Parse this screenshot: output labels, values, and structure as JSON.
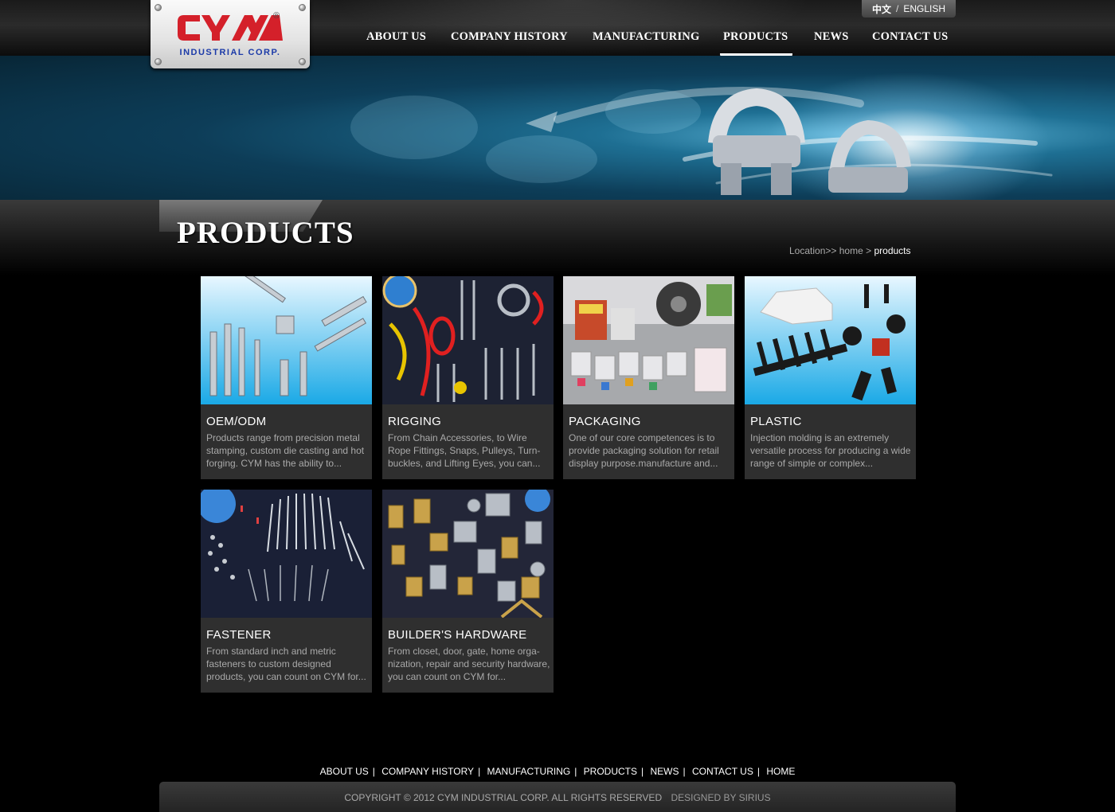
{
  "brand": {
    "corp_name": "INDUSTRIAL  CORP.",
    "registered": "®",
    "colors": {
      "red": "#d4202a",
      "blue": "#1b3aa8"
    }
  },
  "lang": {
    "chinese": "中文",
    "separator": "/",
    "english": "ENGLISH"
  },
  "nav": [
    "ABOUT US",
    "COMPANY HISTORY",
    "MANUFACTURING",
    "PRODUCTS",
    "NEWS",
    "CONTACT US"
  ],
  "nav_active": "PRODUCTS",
  "page_title": "PRODUCTS",
  "breadcrumb": {
    "prefix": "Location>>",
    "home": "home",
    "sep": ">",
    "current": "products"
  },
  "products": [
    {
      "name": "OEM/ODM",
      "desc": "Products range from precision metal stamping, custom die casting and hot forging.  CYM has the ability to..."
    },
    {
      "name": "RIGGING",
      "desc": "From Chain Accessories, to Wire Rope Fittings, Snaps, Pulleys, Turn-buckles, and Lifting Eyes, you can..."
    },
    {
      "name": "PACKAGING",
      "desc": "One of our core competences is to provide packaging solution for retail display purpose.manufacture and..."
    },
    {
      "name": "PLASTIC",
      "desc": "Injection molding is an extremely versatile process for producing a wide range of simple or complex..."
    },
    {
      "name": "FASTENER",
      "desc": "From standard inch and metric fasteners to custom designed products, you can count on CYM for..."
    },
    {
      "name": "BUILDER'S HARDWARE",
      "desc": "From closet, door, gate, home orga-nization, repair and security hardware, you can count on CYM for..."
    }
  ],
  "footer": {
    "links": [
      "ABOUT US",
      "COMPANY HISTORY",
      "MANUFACTURING",
      "PRODUCTS",
      "NEWS",
      "CONTACT US",
      "HOME"
    ],
    "copyright": "COPYRIGHT © 2012 CYM INDUSTRIAL CORP. ALL RIGHTS RESERVED",
    "designed": "DESIGNED BY SIRIUS"
  }
}
